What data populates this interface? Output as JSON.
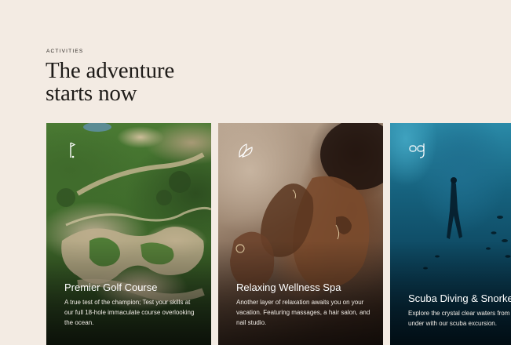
{
  "section": {
    "eyebrow": "ACTIVITIES",
    "headline_line1": "The adventure",
    "headline_line2": "starts now"
  },
  "cards": [
    {
      "title": "Premier Golf Course",
      "description": "A true test of the champion; Test your skills at our full 18-hole immaculate course overlooking the ocean.",
      "icon": "golf-flag-icon"
    },
    {
      "title": "Relaxing Wellness Spa",
      "description": "Another layer of relaxation awaits you on your vacation. Featuring massages, a hair salon, and nail studio.",
      "icon": "leaf-icon"
    },
    {
      "title": "Scuba Diving & Snorkel",
      "description": "Explore the crystal clear waters from under with our scuba excursion.",
      "icon": "diving-mask-icon"
    }
  ],
  "colors": {
    "background": "#f3ebe3",
    "heading": "#1e1b18",
    "card_text": "#ffffff"
  }
}
